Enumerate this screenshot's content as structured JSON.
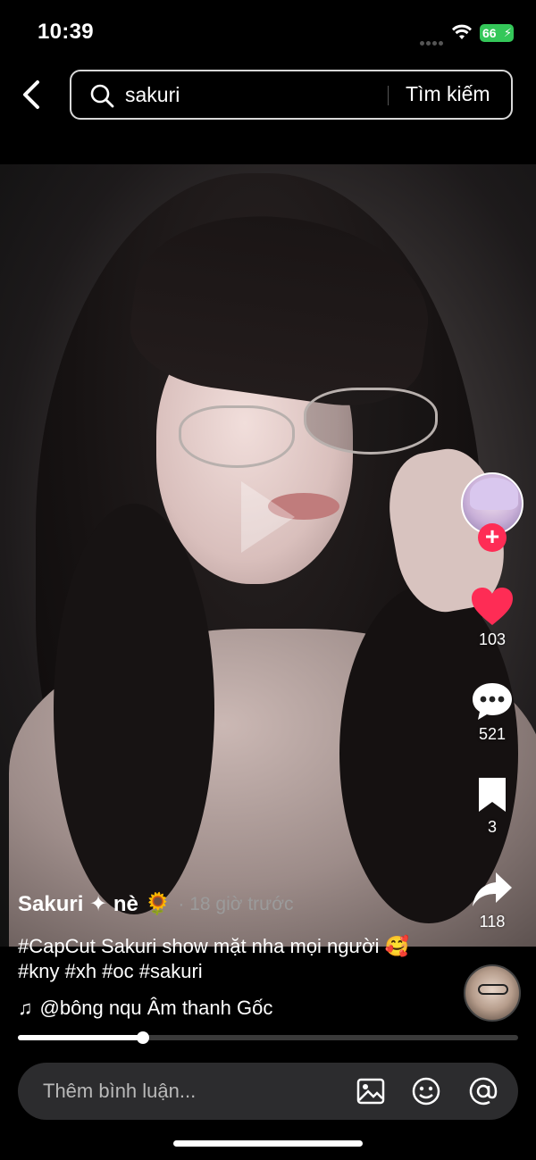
{
  "status_bar": {
    "time": "10:39",
    "battery": "66"
  },
  "search": {
    "query": "sakuri",
    "submit_label": "Tìm kiếm"
  },
  "actions": {
    "likes": "103",
    "comments": "521",
    "bookmarks": "3",
    "shares": "118"
  },
  "post": {
    "author": "Sakuri ✦ nè 🌻",
    "time_ago": "· 18 giờ trước",
    "caption": "#CapCut Sakuri show mặt nha mọi người 🥰 #kny #xh #oc #sakuri",
    "music": "@bông nqu Âm thanh Gốc"
  },
  "playback": {
    "progress_percent": 25
  },
  "comment_bar": {
    "placeholder": "Thêm bình luận..."
  },
  "icons": [
    "back-icon",
    "search-icon",
    "wifi-icon",
    "play-icon",
    "plus-icon",
    "heart-icon",
    "comment-icon",
    "bookmark-icon",
    "share-icon",
    "music-note-icon",
    "image-icon",
    "emoji-icon",
    "mention-icon"
  ],
  "colors": {
    "accent": "#fe2c55",
    "battery": "#34c759",
    "background": "#000000"
  }
}
